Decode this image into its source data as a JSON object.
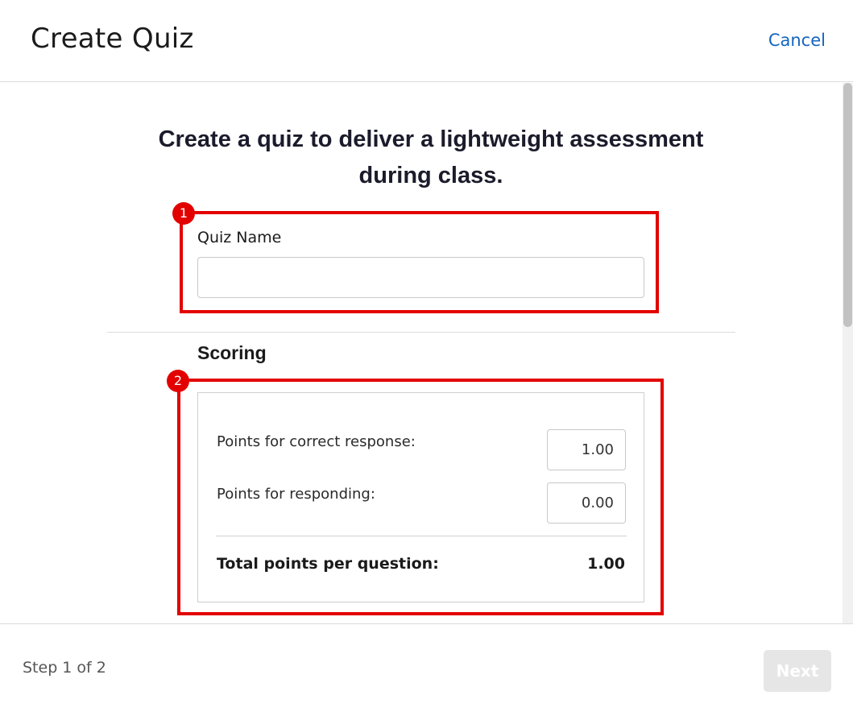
{
  "header": {
    "title": "Create Quiz",
    "cancel_label": "Cancel"
  },
  "main": {
    "intro": "Create a quiz to deliver a lightweight assessment during class.",
    "quiz_name": {
      "label": "Quiz Name",
      "value": ""
    },
    "scoring": {
      "title": "Scoring",
      "correct_label": "Points for correct response:",
      "correct_value": "1.00",
      "responding_label": "Points for responding:",
      "responding_value": "0.00",
      "total_label": "Total points per question:",
      "total_value": "1.00"
    }
  },
  "annotations": [
    "1",
    "2"
  ],
  "footer": {
    "step": "Step 1 of 2",
    "next_label": "Next"
  },
  "colors": {
    "accent": "#1565c0",
    "highlight": "#e30000",
    "disabled_button": "#e6e6e6"
  }
}
